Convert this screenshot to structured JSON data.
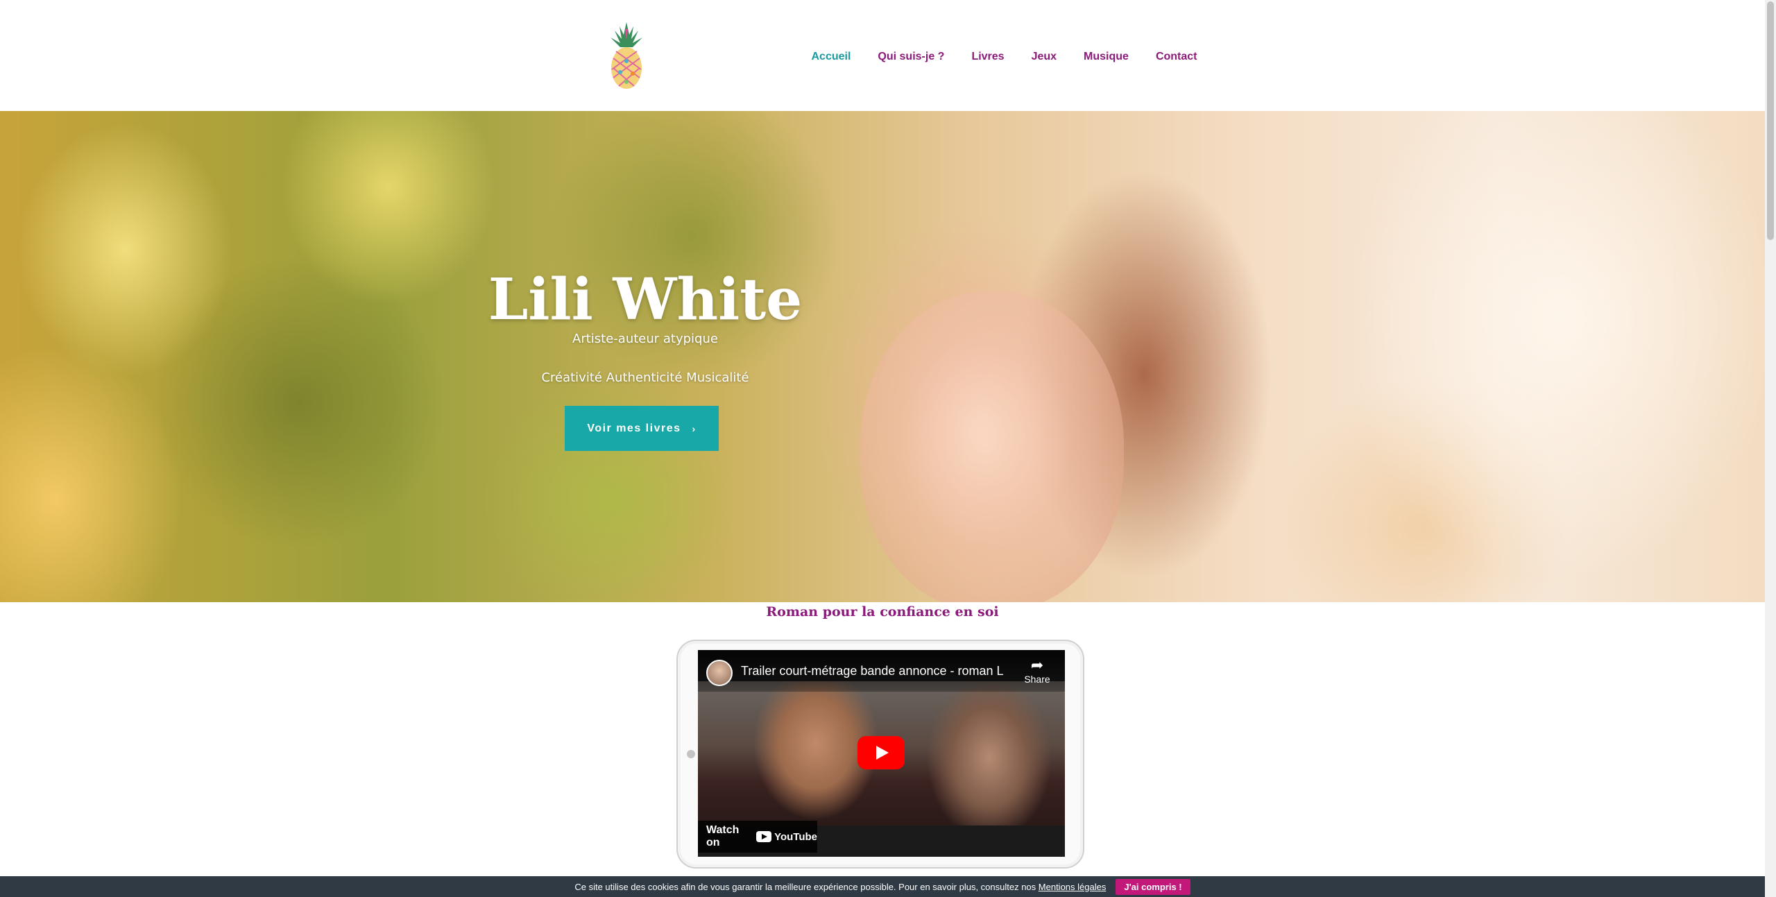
{
  "header": {
    "logo_icon": "pineapple-logo-icon",
    "nav": [
      {
        "label": "Accueil",
        "active": true
      },
      {
        "label": "Qui suis-je ?",
        "active": false
      },
      {
        "label": "Livres",
        "active": false
      },
      {
        "label": "Jeux",
        "active": false
      },
      {
        "label": "Musique",
        "active": false
      },
      {
        "label": "Contact",
        "active": false
      }
    ]
  },
  "hero": {
    "title": "Lili White",
    "subtitle": "Artiste-auteur atypique",
    "values": "Créativité Authenticité Musicalité",
    "button_label": "Voir mes livres",
    "button_icon": "chevron-right-icon"
  },
  "section": {
    "title": "Roman pour la confiance en soi"
  },
  "video": {
    "title": "Trailer court-métrage bande annonce - roman L...",
    "share_label": "Share",
    "watch_on": "Watch on",
    "youtube_label": "YouTube"
  },
  "cookie": {
    "text": "Ce site utilise des cookies afin de vous garantir la meilleure expérience possible. Pour en savoir plus, consultez nos",
    "link": "Mentions légales",
    "button": "J'ai compris !"
  },
  "colors": {
    "nav_text": "#8b1a7a",
    "nav_active": "#1a9aa0",
    "cta": "#18a8a8",
    "cookie_bar": "#2f3a45",
    "cookie_button": "#c2187a"
  }
}
